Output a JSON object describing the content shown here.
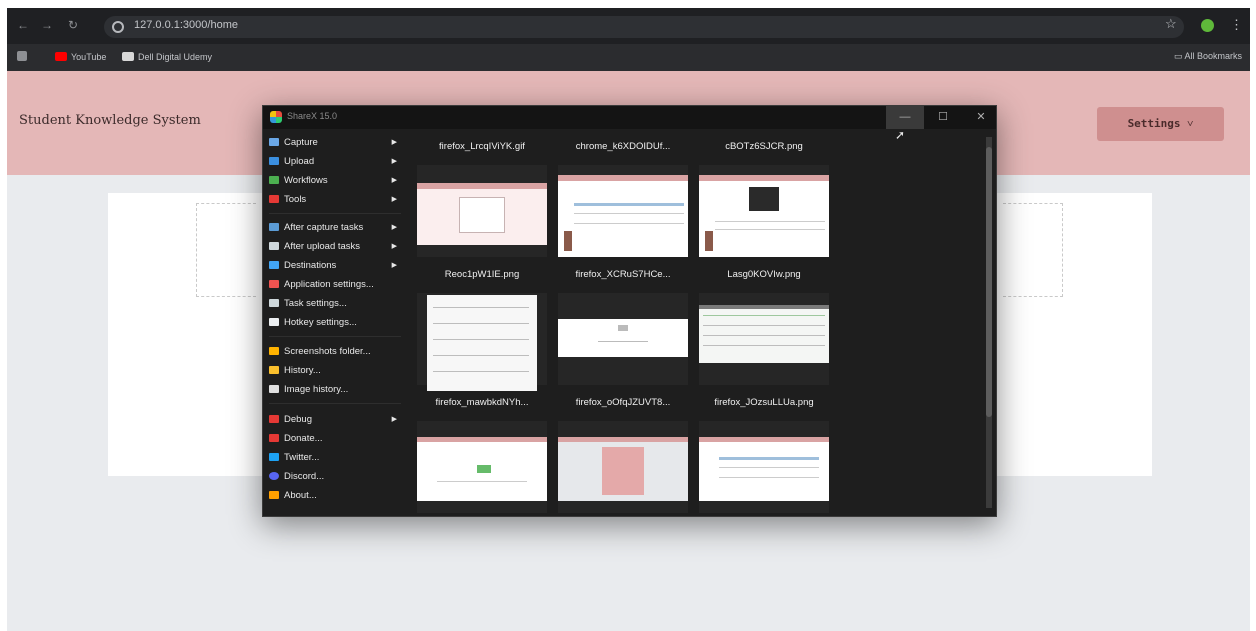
{
  "browser": {
    "url": "127.0.0.1:3000/home",
    "bookmarks": [
      {
        "label": "YouTube",
        "color": "#ff0000"
      },
      {
        "label": "Dell Digital Udemy",
        "color": "#d8d8d8"
      }
    ],
    "all_bookmarks": "All Bookmarks",
    "profile_color": "#5fb93a"
  },
  "app": {
    "brand": "Student Knowledge System",
    "settings_label": "Settings ˅",
    "header_color": "#e4b7b7",
    "button_color": "#cf8f8f"
  },
  "sharex": {
    "title": "ShareX 15.0",
    "menu": [
      {
        "label": "Capture",
        "icon": "capture-icon",
        "color": "#6aa7e6",
        "has_submenu": true
      },
      {
        "label": "Upload",
        "icon": "upload-icon",
        "color": "#3b8fe0",
        "has_submenu": true
      },
      {
        "label": "Workflows",
        "icon": "workflows-icon",
        "color": "#4caf50",
        "has_submenu": true
      },
      {
        "label": "Tools",
        "icon": "tools-icon",
        "color": "#e53935",
        "has_submenu": true
      },
      {
        "label": "After capture tasks",
        "icon": "after-capture-icon",
        "color": "#5b9bd5",
        "has_submenu": true
      },
      {
        "label": "After upload tasks",
        "icon": "after-upload-icon",
        "color": "#cfd8dc",
        "has_submenu": true
      },
      {
        "label": "Destinations",
        "icon": "destinations-icon",
        "color": "#42a5f5",
        "has_submenu": true
      },
      {
        "label": "Application settings...",
        "icon": "application-settings-icon",
        "color": "#ef5350",
        "has_submenu": false
      },
      {
        "label": "Task settings...",
        "icon": "task-settings-icon",
        "color": "#cfd8dc",
        "has_submenu": false
      },
      {
        "label": "Hotkey settings...",
        "icon": "hotkey-settings-icon",
        "color": "#eceff1",
        "has_submenu": false
      },
      {
        "label": "Screenshots folder...",
        "icon": "screenshots-folder-icon",
        "color": "#ffb300",
        "has_submenu": false
      },
      {
        "label": "History...",
        "icon": "history-icon",
        "color": "#fbc02d",
        "has_submenu": false
      },
      {
        "label": "Image history...",
        "icon": "image-history-icon",
        "color": "#e0e0e0",
        "has_submenu": false
      },
      {
        "label": "Debug",
        "icon": "debug-icon",
        "color": "#e53935",
        "has_submenu": true
      },
      {
        "label": "Donate...",
        "icon": "donate-icon",
        "color": "#e53935",
        "has_submenu": false
      },
      {
        "label": "Twitter...",
        "icon": "twitter-icon",
        "color": "#1da1f2",
        "has_submenu": false
      },
      {
        "label": "Discord...",
        "icon": "discord-icon",
        "color": "#5865f2",
        "has_submenu": false
      },
      {
        "label": "About...",
        "icon": "about-icon",
        "color": "#ffa000",
        "has_submenu": false
      }
    ],
    "thumbnails": [
      {
        "name": "firefox_LrcqIViYK.gif",
        "style": "pink-form"
      },
      {
        "name": "chrome_k6XDOIDUf...",
        "style": "pink-table"
      },
      {
        "name": "cBOTz6SJCR.png",
        "style": "pink-table-dialog"
      },
      {
        "name": "Reoc1pW1IE.png",
        "style": "document"
      },
      {
        "name": "firefox_XCRuS7HCe...",
        "style": "diagram"
      },
      {
        "name": "Lasg0KOVIw.png",
        "style": "spreadsheet"
      },
      {
        "name": "firefox_mawbkdNYh...",
        "style": "form"
      },
      {
        "name": "firefox_oOfqJZUVT8...",
        "style": "pink-card"
      },
      {
        "name": "firefox_JOzsuLLUa.png",
        "style": "pink-table"
      }
    ]
  }
}
